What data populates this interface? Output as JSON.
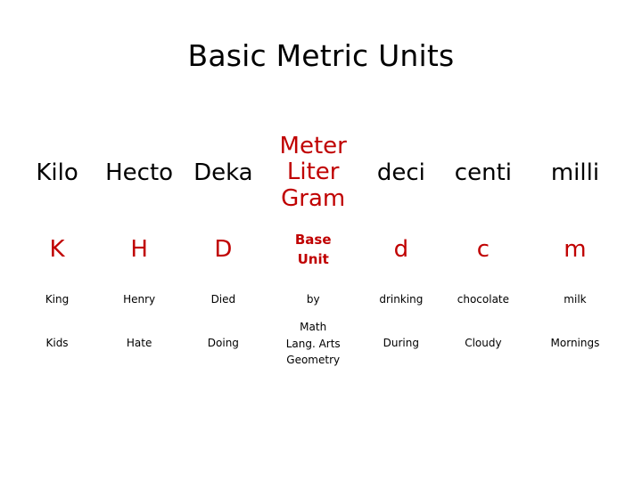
{
  "slide": {
    "title": "Basic Metric Units",
    "title_color": "#000000",
    "accent_color": "#C00000",
    "background_color": "#FFFFFF"
  },
  "table": {
    "columns": [
      "kilo",
      "hecto",
      "deka",
      "base",
      "deci",
      "centi",
      "milli"
    ],
    "rows": {
      "prefix_names": {
        "kilo": "Kilo",
        "hecto": "Hecto",
        "deka": "Deka",
        "base_line1": "Meter",
        "base_line2": "Liter",
        "base_line3": "Gram",
        "deci": "deci",
        "centi": "centi",
        "milli": "milli"
      },
      "abbreviations": {
        "kilo": "K",
        "hecto": "H",
        "deka": "D",
        "base_line1": "Base",
        "base_line2": "Unit",
        "deci": "d",
        "centi": "c",
        "milli": "m"
      },
      "mnemonic_one": {
        "kilo": "King",
        "hecto": "Henry",
        "deka": "Died",
        "base": "by",
        "deci": "drinking",
        "centi": "chocolate",
        "milli": "milk"
      },
      "mnemonic_two": {
        "kilo": "Kids",
        "hecto": "Hate",
        "deka": "Doing",
        "base_line1": "Math",
        "base_line2": "Lang. Arts",
        "base_line3": "Geometry",
        "deci": "During",
        "centi": "Cloudy",
        "milli": "Mornings"
      }
    }
  }
}
